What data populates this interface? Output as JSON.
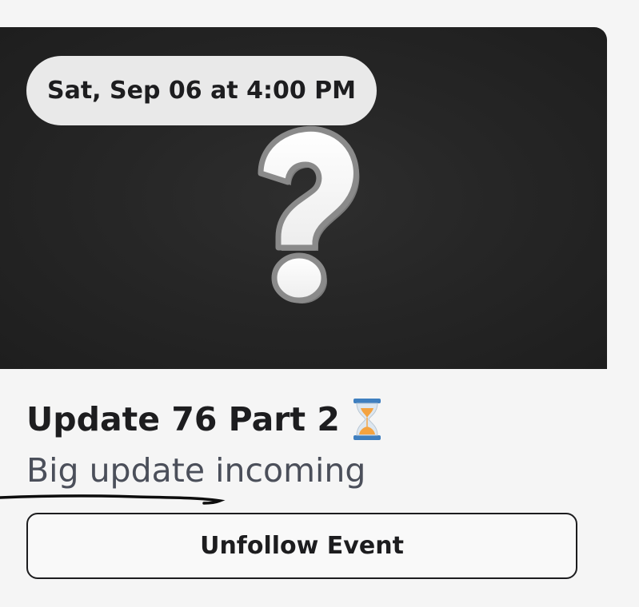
{
  "event": {
    "date_label": "Sat, Sep 06 at 4:00 PM",
    "image_icon": "question-mark-icon",
    "title": "Update 76 Part 2",
    "title_emoji": "hourglass-icon",
    "description": "Big update incoming",
    "unfollow_label": "Unfollow Event"
  },
  "colors": {
    "page_background": "#f5f5f5",
    "image_background": "#262626",
    "pill_background": "#e9e9e9",
    "text_primary": "#1d1d1f",
    "text_secondary": "#4b4f5a"
  }
}
